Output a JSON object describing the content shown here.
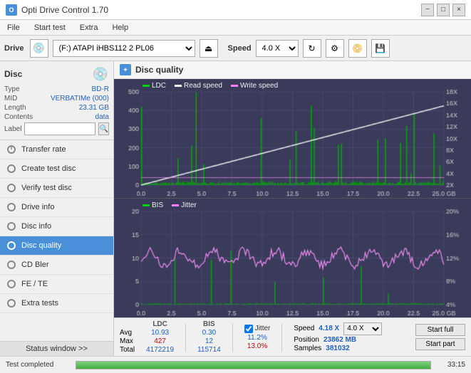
{
  "app": {
    "title": "Opti Drive Control 1.70",
    "minimize_label": "−",
    "maximize_label": "□",
    "close_label": "×"
  },
  "menu": {
    "items": [
      "File",
      "Start test",
      "Extra",
      "Help"
    ]
  },
  "toolbar": {
    "drive_label": "Drive",
    "drive_value": "(F:)  ATAPI iHBS112  2 PL06",
    "speed_label": "Speed",
    "speed_value": "4.0 X"
  },
  "disc": {
    "section_label": "Disc",
    "type_label": "Type",
    "type_value": "BD-R",
    "mid_label": "MID",
    "mid_value": "VERBATIMe (000)",
    "length_label": "Length",
    "length_value": "23.31 GB",
    "contents_label": "Contents",
    "contents_value": "data",
    "label_label": "Label",
    "label_value": ""
  },
  "nav": {
    "items": [
      {
        "id": "transfer-rate",
        "label": "Transfer rate",
        "active": false
      },
      {
        "id": "create-test-disc",
        "label": "Create test disc",
        "active": false
      },
      {
        "id": "verify-test-disc",
        "label": "Verify test disc",
        "active": false
      },
      {
        "id": "drive-info",
        "label": "Drive info",
        "active": false
      },
      {
        "id": "disc-info",
        "label": "Disc info",
        "active": false
      },
      {
        "id": "disc-quality",
        "label": "Disc quality",
        "active": true
      },
      {
        "id": "cd-bler",
        "label": "CD Bler",
        "active": false
      },
      {
        "id": "fe-te",
        "label": "FE / TE",
        "active": false
      },
      {
        "id": "extra-tests",
        "label": "Extra tests",
        "active": false
      }
    ],
    "status_window": "Status window >>"
  },
  "disc_quality": {
    "title": "Disc quality",
    "legend": {
      "ldc_label": "LDC",
      "read_speed_label": "Read speed",
      "write_speed_label": "Write speed",
      "bis_label": "BIS",
      "jitter_label": "Jitter"
    }
  },
  "chart_top": {
    "y_left": [
      "500",
      "400",
      "300",
      "200",
      "100",
      "0"
    ],
    "y_right": [
      "18X",
      "16X",
      "14X",
      "12X",
      "10X",
      "8X",
      "6X",
      "4X",
      "2X"
    ],
    "x_labels": [
      "0.0",
      "2.5",
      "5.0",
      "7.5",
      "10.0",
      "12.5",
      "15.0",
      "17.5",
      "20.0",
      "22.5",
      "25.0 GB"
    ]
  },
  "chart_bottom": {
    "y_left": [
      "20",
      "15",
      "10",
      "5",
      "0"
    ],
    "y_right": [
      "20%",
      "16%",
      "12%",
      "8%",
      "4%"
    ],
    "x_labels": [
      "0.0",
      "2.5",
      "5.0",
      "7.5",
      "10.0",
      "12.5",
      "15.0",
      "17.5",
      "20.0",
      "22.5",
      "25.0 GB"
    ]
  },
  "stats": {
    "ldc_header": "LDC",
    "bis_header": "BIS",
    "jitter_header": "Jitter",
    "avg_label": "Avg",
    "max_label": "Max",
    "total_label": "Total",
    "ldc_avg": "10.93",
    "ldc_max": "427",
    "ldc_total": "4172219",
    "bis_avg": "0.30",
    "bis_max": "12",
    "bis_total": "115714",
    "jitter_checked": true,
    "jitter_avg": "11.2%",
    "jitter_max": "13.0%",
    "jitter_total": "",
    "speed_label": "Speed",
    "speed_value": "4.18 X",
    "speed_select": "4.0 X",
    "position_label": "Position",
    "position_value": "23862 MB",
    "samples_label": "Samples",
    "samples_value": "381032",
    "start_full_label": "Start full",
    "start_part_label": "Start part"
  },
  "status_bar": {
    "text": "Test completed",
    "progress": 100,
    "time": "33:15"
  }
}
